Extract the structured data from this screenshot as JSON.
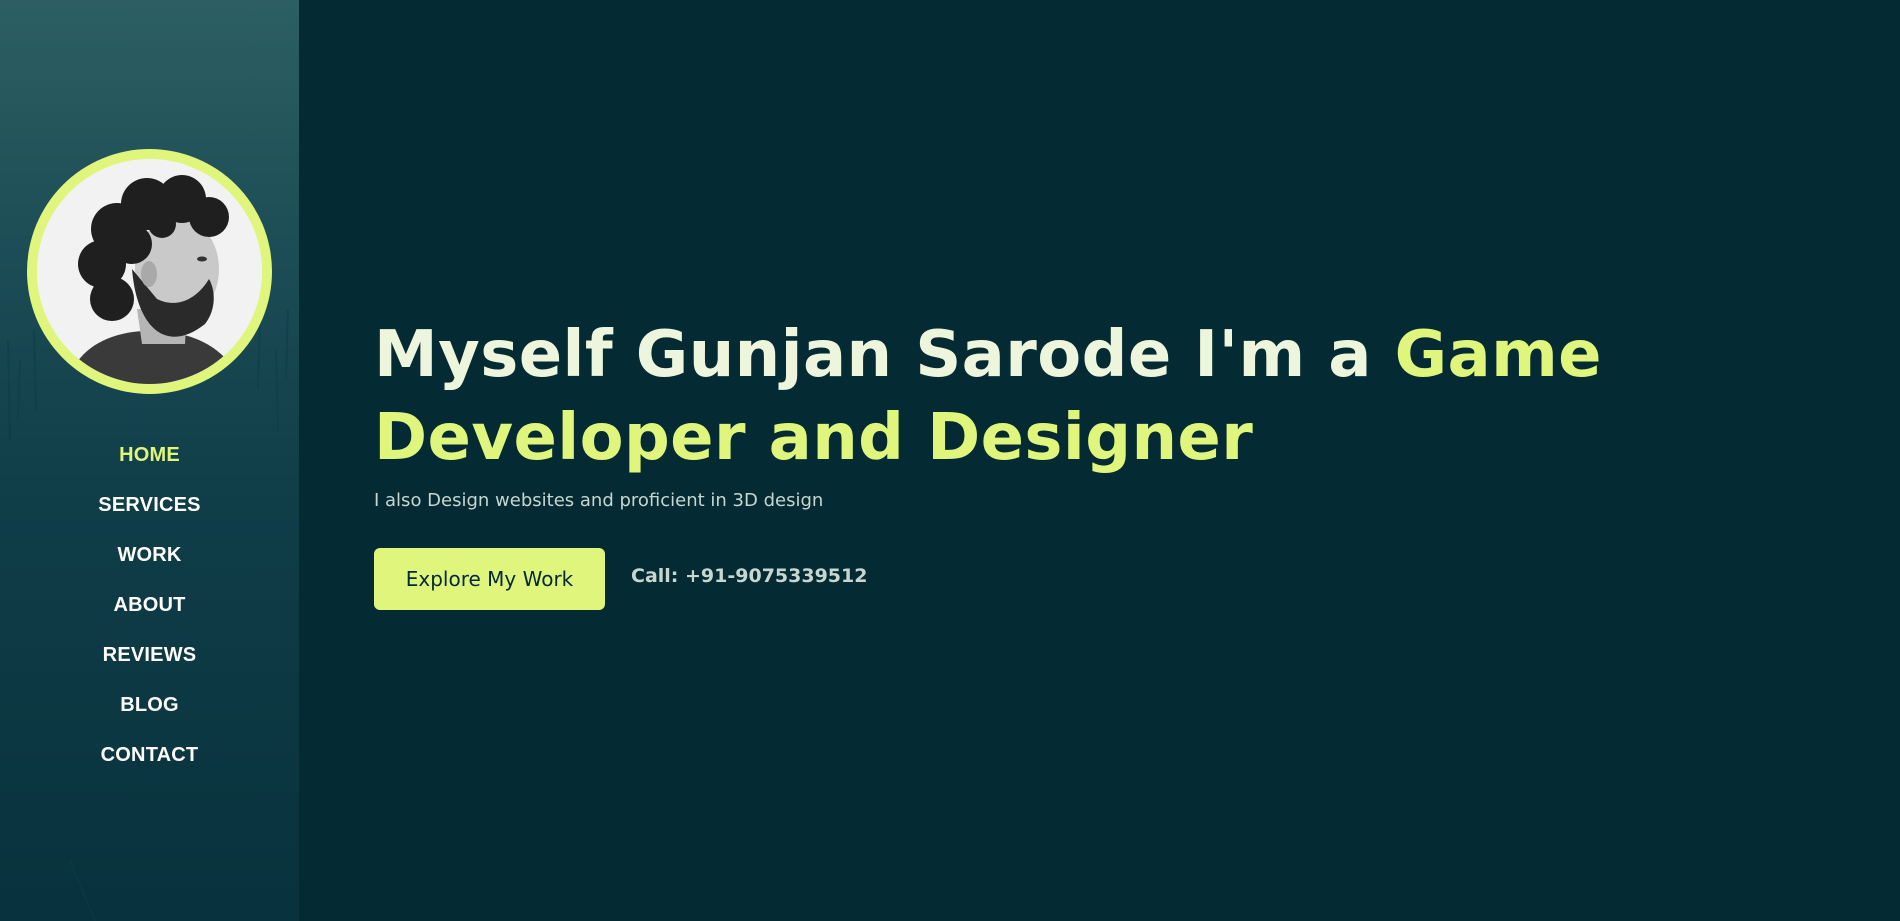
{
  "sidebar": {
    "avatar_alt": "Profile photo",
    "nav": [
      {
        "label": "HOME",
        "active": true
      },
      {
        "label": "SERVICES",
        "active": false
      },
      {
        "label": "WORK",
        "active": false
      },
      {
        "label": "ABOUT",
        "active": false
      },
      {
        "label": "REVIEWS",
        "active": false
      },
      {
        "label": "BLOG",
        "active": false
      },
      {
        "label": "CONTACT",
        "active": false
      }
    ]
  },
  "hero": {
    "headline_plain": "Myself Gunjan Sarode I'm a ",
    "headline_accent": "Game Developer and Designer",
    "subtitle": "I also Design websites and proficient in 3D design",
    "cta_label": "Explore My Work",
    "call_text": "Call: +91-9075339512"
  },
  "colors": {
    "background": "#042a33",
    "accent": "#dff57c",
    "headline_text": "#eef5dd",
    "muted_text": "#c7d6cf",
    "sidebar_top": "#2c5f63",
    "sidebar_bottom": "#08323d"
  }
}
